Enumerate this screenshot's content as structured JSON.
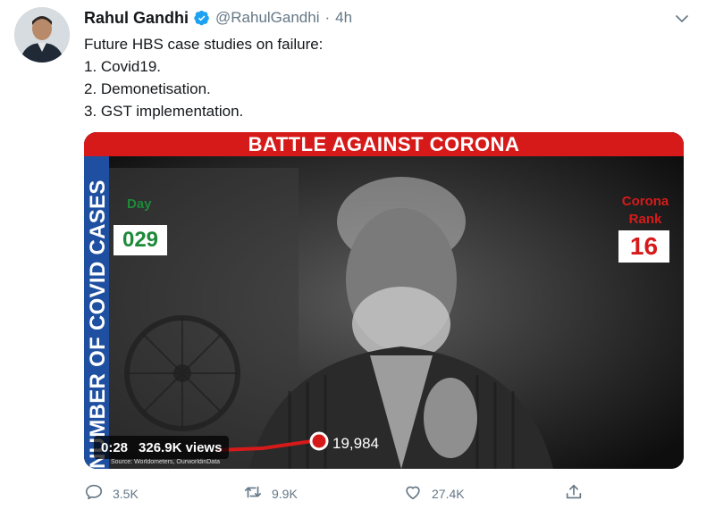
{
  "tweet": {
    "author_name": "Rahul Gandhi",
    "handle": "@RahulGandhi",
    "separator": "·",
    "time": "4h",
    "text_lines": [
      "Future HBS case studies on failure:",
      "1. Covid19.",
      "2. Demonetisation.",
      "3. GST implementation."
    ]
  },
  "video": {
    "banner": "BATTLE AGAINST CORONA",
    "side_label": "NUMBER OF COVID CASES",
    "day_label": "Day",
    "day_value": "029",
    "rank_label_line1": "Corona",
    "rank_label_line2": "Rank",
    "rank_value": "16",
    "cases_value": "19,984",
    "source": "Source: Worldometers, OurworldinData",
    "elapsed": "0:28",
    "views": "326.9K views"
  },
  "actions": {
    "reply_count": "3.5K",
    "retweet_count": "9.9K",
    "like_count": "27.4K"
  },
  "colors": {
    "banner_red": "#d61a1a",
    "side_blue": "#1e4fa0",
    "day_green": "#1d8a3a",
    "verified_blue": "#1da1f2"
  }
}
